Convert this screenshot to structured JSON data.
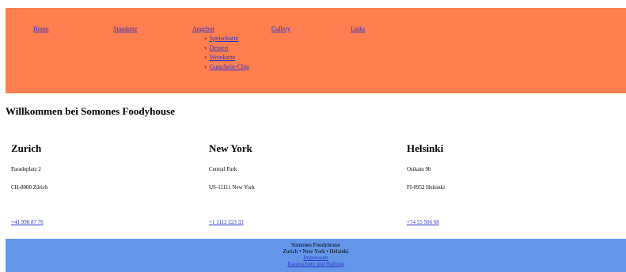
{
  "nav": {
    "items": [
      {
        "label": "Home"
      },
      {
        "label": "Standorte"
      },
      {
        "label": "Angebot"
      },
      {
        "label": "Gallery"
      },
      {
        "label": "Links"
      }
    ],
    "submenu": [
      {
        "label": "Speisekarte"
      },
      {
        "label": "Dessert"
      },
      {
        "label": "Weinkarte"
      },
      {
        "label": "Gutschein-Chip"
      }
    ],
    "bullet": "▾"
  },
  "main": {
    "title": "Willkommen bei Somones Foodyhouse",
    "locations": [
      {
        "city": "Zurich",
        "street": "Paradeplatz 2",
        "postal": "CH-8000 Zürich",
        "phone": "+41 998 87 76"
      },
      {
        "city": "New York",
        "street": "Central Park",
        "postal": "US-11111 New York",
        "phone": "+1 1112 223 33"
      },
      {
        "city": "Helsinki",
        "street": "Osikatu 9b",
        "postal": "FI-0952 Helsinki",
        "phone": "+74 55 566 68"
      }
    ]
  },
  "footer": {
    "name": "Somones Foodyhouse",
    "cities": "Zurich • New York • Helsinki",
    "links": [
      "Impressum",
      "Datenschutz und Haftung"
    ]
  },
  "colors": {
    "nav_bg": "#ff7f50",
    "footer_bg": "#6496e8",
    "link": "#2b33c8"
  }
}
